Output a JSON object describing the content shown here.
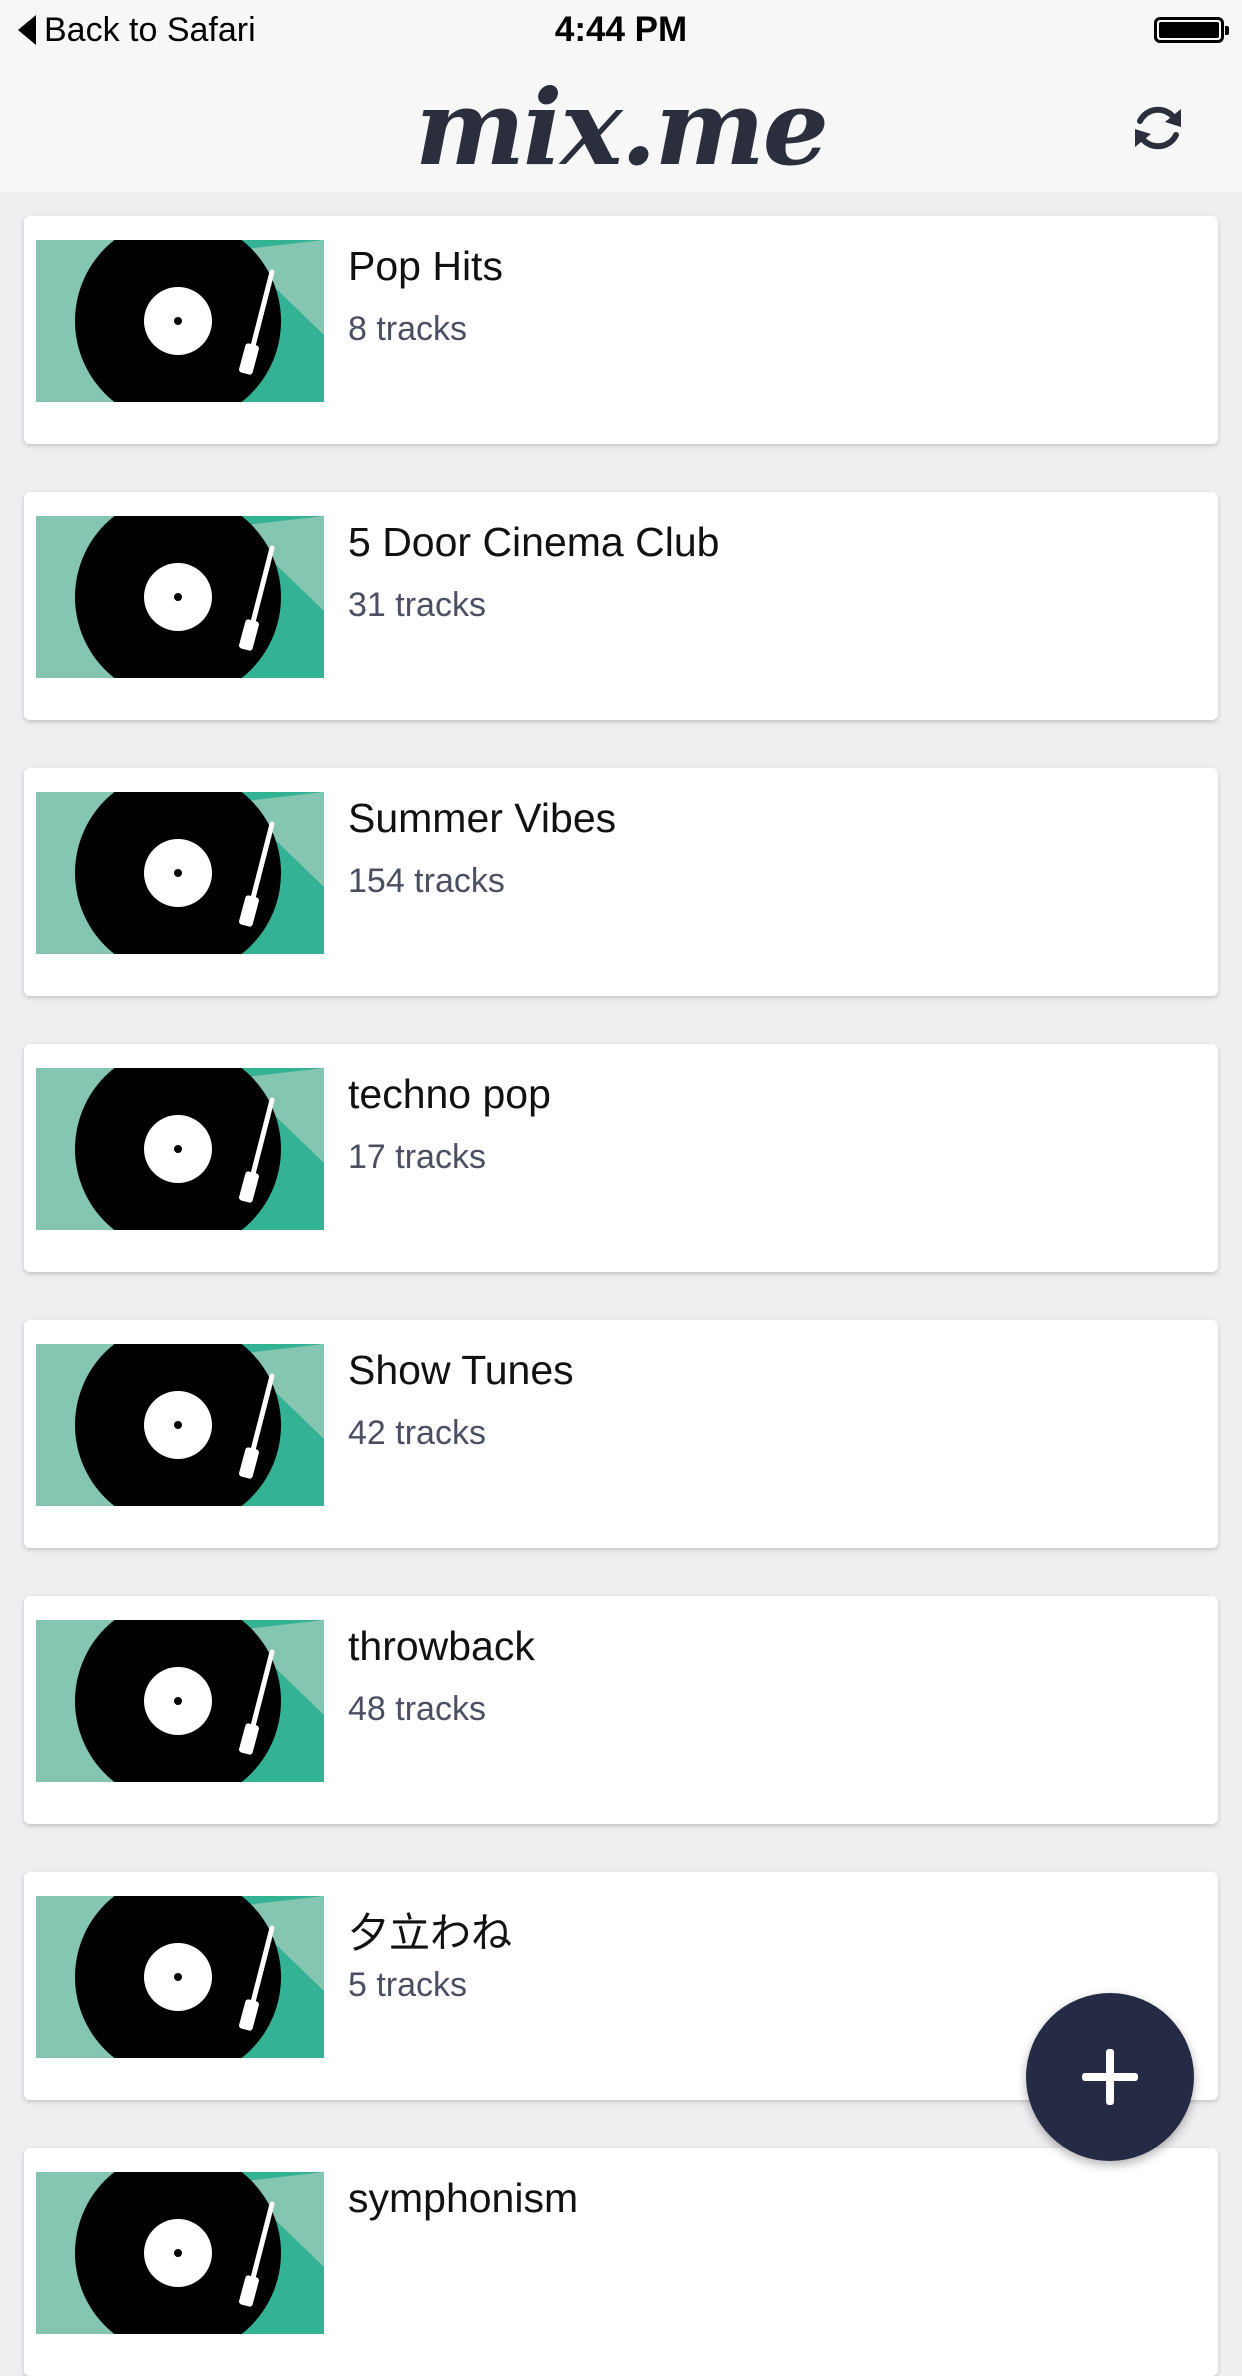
{
  "status_bar": {
    "back_label": "Back to Safari",
    "time": "4:44 PM"
  },
  "header": {
    "logo": "mix.me",
    "refresh_icon": "refresh-icon"
  },
  "colors": {
    "fab": "#252a45",
    "thumb_light": "#84c6b1",
    "thumb_dark": "#33b393",
    "record": "#000000"
  },
  "playlists": [
    {
      "name": "Pop Hits",
      "tracks": "8 tracks"
    },
    {
      "name": "5 Door Cinema Club",
      "tracks": "31 tracks"
    },
    {
      "name": "Summer Vibes",
      "tracks": "154 tracks"
    },
    {
      "name": "techno pop",
      "tracks": "17 tracks"
    },
    {
      "name": "Show Tunes",
      "tracks": "42 tracks"
    },
    {
      "name": "throwback",
      "tracks": "48 tracks"
    },
    {
      "name": "夕立わね",
      "tracks": "5 tracks"
    },
    {
      "name": "symphonism",
      "tracks": ""
    }
  ],
  "fab": {
    "icon": "plus-icon"
  }
}
